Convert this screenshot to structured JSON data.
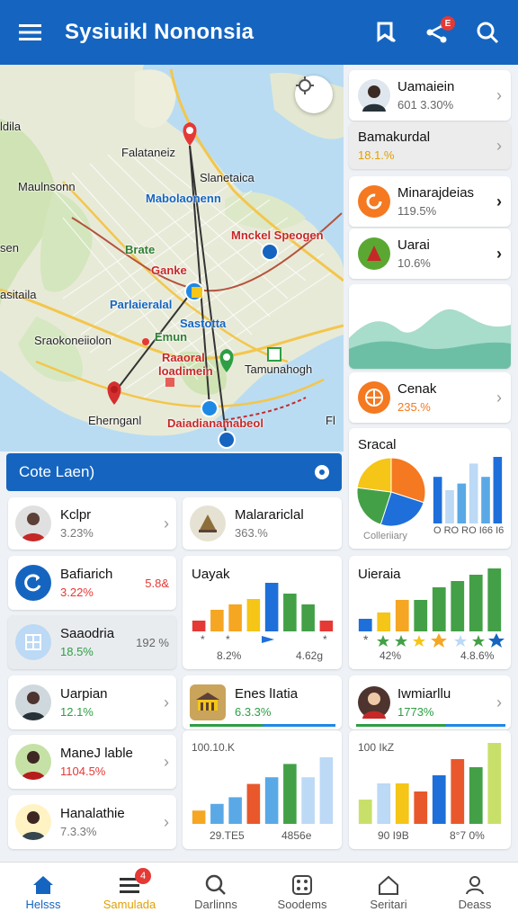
{
  "app": {
    "title": "Sysiuikl Nononsia",
    "badge": "E"
  },
  "map": {
    "labels": {
      "l1": "Falataneiz",
      "l2": "Slanetaica",
      "l3": "Maulnsonn",
      "l4": "Mabolaonenn",
      "l5": "Mnckel Speogen",
      "l6": "Brate",
      "l7": "Ganke",
      "l8": "Parlaieralal",
      "l9": "Sastotta",
      "l10": "Sraokoneiiolon",
      "l11": "Emun",
      "l12": "Raaoral",
      "l13": "loadimein",
      "l14": "Tamunahogh",
      "l15": "Ehernganl",
      "l16": "Daiadianamabeol",
      "l17": "asitaila",
      "l18": "ldila",
      "l19": "sen",
      "l20": "Fl"
    },
    "banner": "Cote Laen)"
  },
  "right_list": [
    {
      "name": "Uamaiein",
      "value": "601 3.30%"
    },
    {
      "name": "Bamakurdal",
      "value": "18.1.%"
    },
    {
      "name": "Minarajdeias",
      "value": "119.5%"
    },
    {
      "name": "Uarai",
      "value": "10.6%"
    },
    {
      "name": "Cenak",
      "value": "235.%"
    }
  ],
  "pie_card": {
    "title": "Sracal",
    "caption": "Colleriiary",
    "foot": "O RO RO I66 I6"
  },
  "left_list": [
    {
      "name": "Kclpr",
      "value": "3.23%"
    },
    {
      "name": "Bafiarich",
      "value": "3.22%",
      "extra": "5.8&"
    },
    {
      "name": "Saaodria",
      "value": "18.5%",
      "extra": "192 %"
    },
    {
      "name": "Uarpian",
      "value": "12.1%"
    },
    {
      "name": "ManeJ lable",
      "value": "1104.5%"
    },
    {
      "name": "Hanalathie",
      "value": "7.3.3%"
    }
  ],
  "mid_list": [
    {
      "name": "Malarariclal",
      "value": "363.%"
    },
    {
      "name": "Enes lIatia",
      "value": "6.3.3%"
    },
    {
      "name": "Iwmiarllu",
      "value": "1773%"
    }
  ],
  "charts": {
    "uayak": {
      "title": "Uayak",
      "foot_left": "8.2%",
      "foot_right": "4.62g"
    },
    "uieraia": {
      "title": "Uieraia",
      "foot_left": "42%",
      "foot_right": "4.8.6%"
    },
    "enes": {
      "label": "100.10.K",
      "foot_left": "29.TE5",
      "foot_right": "4856e"
    },
    "iwm": {
      "label": "100 IkZ",
      "foot_left": "90 I9B",
      "foot_right": "8°7 0%"
    }
  },
  "chart_data": [
    {
      "type": "bar",
      "title": "Uayak",
      "values": [
        2,
        4,
        5,
        6,
        9,
        7,
        5,
        2
      ],
      "colors": [
        "#e53935",
        "#f5a623",
        "#f5a623",
        "#f5c518",
        "#1e6fd9",
        "#43a047",
        "#43a047",
        "#e53935"
      ]
    },
    {
      "type": "bar",
      "title": "Uieraia",
      "values": [
        2,
        3,
        5,
        5,
        7,
        8,
        9,
        10
      ],
      "colors": [
        "#1e6fd9",
        "#f5c518",
        "#f5a623",
        "#43a047",
        "#43a047",
        "#43a047",
        "#43a047",
        "#43a047"
      ]
    },
    {
      "type": "bar",
      "title": "",
      "values": [
        2,
        3,
        4,
        6,
        7,
        9,
        7,
        10
      ],
      "colors": [
        "#f5a623",
        "#5aa9e6",
        "#5aa9e6",
        "#e8582c",
        "#5aa9e6",
        "#43a047",
        "#bcd9f5",
        "#bcd9f5"
      ]
    },
    {
      "type": "bar",
      "title": "",
      "values": [
        3,
        5,
        5,
        4,
        6,
        8,
        7,
        10
      ],
      "colors": [
        "#c8e06a",
        "#bcd9f5",
        "#f5c518",
        "#e8582c",
        "#1e6fd9",
        "#e8582c",
        "#43a047",
        "#c8e06a"
      ]
    },
    {
      "type": "bar",
      "title": "Sracal",
      "values": [
        7,
        5,
        6,
        9,
        7,
        10
      ],
      "colors": [
        "#1e6fd9",
        "#bcd9f5",
        "#5aa9e6",
        "#bcd9f5",
        "#5aa9e6",
        "#1e6fd9"
      ]
    },
    {
      "type": "pie",
      "title": "Sracal",
      "values": [
        30,
        25,
        22,
        23
      ],
      "colors": [
        "#f47920",
        "#1e6fd9",
        "#43a047",
        "#f5c518"
      ]
    }
  ],
  "bottom_nav": [
    {
      "label": "Helsss",
      "icon": "home-icon"
    },
    {
      "label": "Samulada",
      "icon": "list-icon",
      "badge": "4"
    },
    {
      "label": "Darlinns",
      "icon": "search-icon"
    },
    {
      "label": "Soodems",
      "icon": "dice-icon"
    },
    {
      "label": "Seritari",
      "icon": "house-outline-icon"
    },
    {
      "label": "Deass",
      "icon": "person-icon"
    }
  ],
  "colors": {
    "primary": "#1565c0",
    "accent_red": "#e53935",
    "accent_green": "#2e9e44",
    "accent_orange": "#f47920"
  }
}
